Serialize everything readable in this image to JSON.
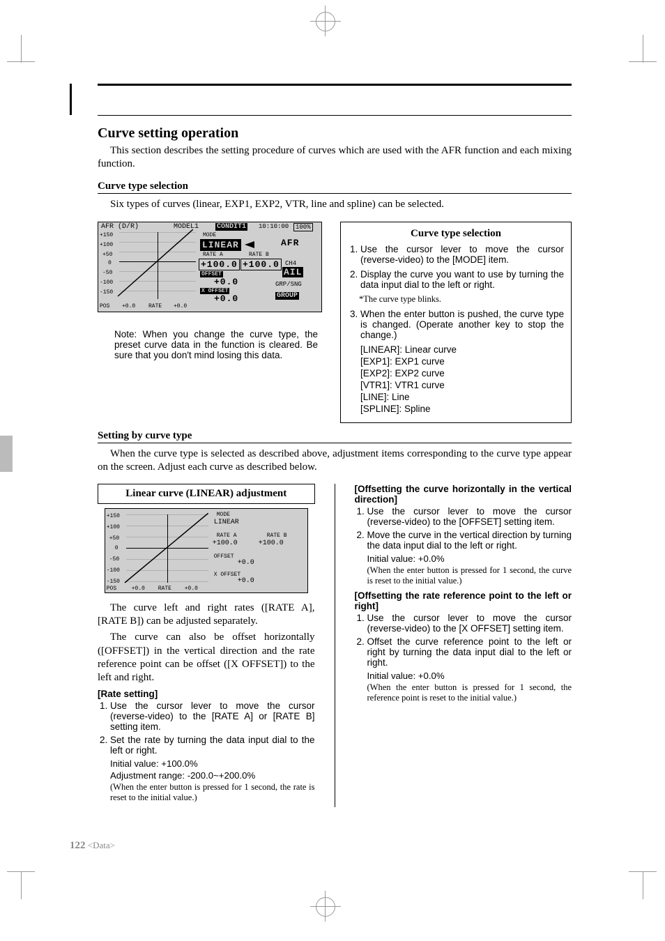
{
  "header": {
    "title": "Curve setting operation",
    "intro": "This section describes the setting procedure of curves which are used with the AFR function and each mixing function."
  },
  "curve_type_selection": {
    "heading": "Curve type selection",
    "line": "Six types of curves (linear, EXP1, EXP2, VTR, line and spline) can be selected."
  },
  "lcd1": {
    "title_left": "AFR (D/R)",
    "title_mid": "MODEL1",
    "title_cond": "CONDIT1",
    "clock": "10:10:00",
    "batt": "100%",
    "mode_lbl": "MODE",
    "mode_val": "LINEAR",
    "afr_tag": "AFR",
    "rate_a_lbl": "RATE A",
    "rate_b_lbl": "RATE B",
    "rate_a_val": "+100.0",
    "rate_b_val": "+100.0",
    "ch": "CH4",
    "ail": "AIL",
    "offset_lbl": "OFFSET",
    "offset_val": "+0.0",
    "grpsng": "GRP/SNG",
    "xoffset_lbl": "X OFFSET",
    "xoffset_val": "+0.0",
    "group": "GROUP",
    "yticks": [
      "+150",
      "+100",
      "+50",
      "0",
      "-50",
      "-100",
      "-150"
    ],
    "pos_lbl": "POS",
    "pos_val": "+0.0",
    "rate_lbl": "RATE",
    "rate_val": "+0.0"
  },
  "callout_note": "Note: When you change the curve type, the preset curve data in the function is cleared. Be sure that you don't mind losing this data.",
  "panel1": {
    "title": "Curve type selection",
    "step1": "Use the cursor lever to move the cursor (reverse-video) to the [MODE] item.",
    "step2": "Display the curve you want to use by turning the data input dial to the left or right.",
    "blinknote": "*The curve type blinks.",
    "step3": "When the enter button is pushed, the curve type is changed. (Operate another key to stop the change.)",
    "c1": "[LINEAR]: Linear curve",
    "c2": "[EXP1]: EXP1 curve",
    "c3": "[EXP2]: EXP2 curve",
    "c4": "[VTR1]: VTR1 curve",
    "c5": "[LINE]: Line",
    "c6": "[SPLINE]: Spline"
  },
  "setting_by_curve": {
    "heading": "Setting by curve type",
    "line": "When the curve type is selected as described above, adjustment items corresponding to the curve type appear on the screen. Adjust each curve as described below."
  },
  "panel_linear_title": "Linear curve (LINEAR) adjustment",
  "lcd2": {
    "mode_lbl": "MODE",
    "mode_val": "LINEAR",
    "rate_a_lbl": "RATE A",
    "rate_b_lbl": "RATE B",
    "rate_a_val": "+100.0",
    "rate_b_val": "+100.0",
    "offset_lbl": "OFFSET",
    "offset_val": "+0.0",
    "xoffset_lbl": "X OFFSET",
    "xoffset_val": "+0.0",
    "yticks": [
      "+150",
      "+100",
      "+50",
      "0",
      "-50",
      "-100",
      "-150"
    ],
    "pos_lbl": "POS",
    "pos_val": "+0.0",
    "rate_lbl": "RATE",
    "rate_val": "+0.0"
  },
  "linear_text": {
    "p1": "The curve left and right rates ([RATE A], [RATE B]) can be adjusted separately.",
    "p2": "The curve can also be offset horizontally ([OFFSET]) in the vertical direction and the rate reference point can be offset ([X OFFSET]) to the left and right.",
    "rate_setting_h": "[Rate setting]",
    "rs1": "Use the cursor lever to move the cursor (reverse-video) to the [RATE A] or [RATE B] setting item.",
    "rs2": "Set the rate by turning the data input dial to the left or right.",
    "rs_init": "Initial value: +100.0%",
    "rs_range": "Adjustment range: -200.0~+200.0%",
    "rs_reset": "(When the enter button is pressed for 1 second, the rate is reset to the initial value.)"
  },
  "right_col": {
    "h1": "[Offsetting the curve horizontally in the vertical direction]",
    "o1": "Use the cursor lever to move the cursor (reverse-video) to the [OFFSET] setting item.",
    "o2": "Move the curve in the vertical direction by turning the data input dial to the left or right.",
    "o_init": "Initial value: +0.0%",
    "o_reset": "(When the enter button is pressed for 1 second, the curve is reset to the initial value.)",
    "h2": "[Offsetting the rate reference point to the left or right]",
    "x1": "Use the cursor lever to move the cursor (reverse-video) to the [X OFFSET] setting item.",
    "x2": "Offset the curve reference point to the left or right by turning the data input dial to the left or right.",
    "x_init": "Initial value: +0.0%",
    "x_reset": "(When the enter button is pressed for 1 second, the reference point is reset to the initial value.)"
  },
  "footer": {
    "page": "122",
    "section": "<Data>"
  }
}
